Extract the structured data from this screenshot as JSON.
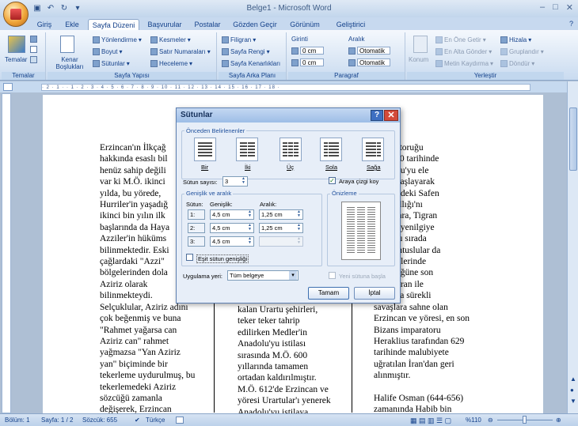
{
  "window": {
    "title": "Belge1 - Microsoft Word"
  },
  "tabs": [
    "Giriş",
    "Ekle",
    "Sayfa Düzeni",
    "Başvurular",
    "Postalar",
    "Gözden Geçir",
    "Görünüm",
    "Geliştirici"
  ],
  "ribbon": {
    "temalar": {
      "label": "Temalar",
      "btn": "Temalar"
    },
    "sayfa_yapisi": {
      "label": "Sayfa Yapısı",
      "kenar": "Kenar Boşlukları",
      "yonlendirme": "Yönlendirme",
      "boyut": "Boyut",
      "sutunlar": "Sütunlar",
      "kesmeler": "Kesmeler",
      "satir_numaralari": "Satır Numaraları",
      "heceleme": "Heceleme"
    },
    "sayfa_arka_plani": {
      "label": "Sayfa Arka Planı",
      "filigran": "Filigran",
      "sayfa_rengi": "Sayfa Rengi",
      "sayfa_kenarliklari": "Sayfa Kenarlıkları"
    },
    "paragraf": {
      "label": "Paragraf",
      "girinti": "Girinti",
      "aralik": "Aralık",
      "sol_val": "0 cm",
      "sag_val": "0 cm",
      "once_val": "Otomatik",
      "sonra_val": "Otomatik"
    },
    "yerlestir": {
      "label": "Yerleştir",
      "konum": "Konum",
      "en_one": "En Öne Getir",
      "en_alta": "En Alta Gönder",
      "metin_kaydirma": "Metin Kaydırma",
      "hizala": "Hizala",
      "gruplandir": "Gruplandır",
      "dondur": "Döndür"
    }
  },
  "document": {
    "col1": [
      "Erzincan'ın İlkçağ",
      "hakkında esaslı bil",
      "henüz sahip değili",
      "var ki M.Ö. ikinci",
      "yılda, bu yörede,",
      "Hurriler'in yaşadığ",
      "ikinci bin yılın ilk",
      "başlarında da Haya",
      "Azziler'in hüküms",
      "bilinmektedir. Eski",
      "çağlardaki \"Azzi\"",
      "bölgelerinden dola",
      "Aziriz olarak",
      "bilinmekteydi.",
      "Selçuklular, Aziriz adını",
      "çok beğenmiş ve buna",
      "\"Rahmet yağarsa can",
      "Aziriz can\" rahmet",
      "yağmazsa \"Yan Aziriz",
      "yan\" biçiminde bir",
      "tekerleme uydurulmuş, bu",
      "tekerlemedeki Aziriz",
      "sözcüğü zamanla",
      "değişerek, Erzincan"
    ],
    "col2": [
      "kalan Urartu şehirleri,",
      "teker teker tahrip",
      "edilirken Medler'in",
      "Anadolu'yu istilası",
      "sırasında M.Ö. 600",
      "yıllarında tamamen",
      "ortadan kaldırılmıştır.",
      "M.Ö. 612'de Erzincan ve",
      "yöresi Urartular'ı yenerek",
      "Anadolu'yu istilaya"
    ],
    "col3": [
      "İmparatoruğu",
      "M.Ö. 70 tarihinde",
      "Anadolu'yu ele",
      "meye başlayarak",
      "yöresindeki Safen",
      "at) Krallığı'nı",
      "dan sonra, Tigran",
      "unu da yenilgiye",
      "ıştır. Bu sırada",
      "68) Pontuslular da",
      "an yörelerinde",
      "üstünlüğüne son",
      "lerdir. İran ile",
      "arasında sürekli",
      "savaşlara sahne olan",
      "Erzincan ve yöresi, en son",
      "Bizans imparatoru",
      "Heraklius tarafından 629",
      "tarihinde malubiyete",
      "uğratılan İran'dan geri",
      "alınmıştır.",
      "",
      "Halife Osman (644-656)",
      "zamanında Habib bin"
    ]
  },
  "dialog": {
    "title": "Sütunlar",
    "presets_label": "Önceden Belirlenenler",
    "presets": [
      "Bir",
      "İki",
      "Üç",
      "Sola",
      "Sağa"
    ],
    "sutun_sayisi_label": "Sütun sayısı:",
    "sutun_sayisi": "3",
    "araya_cizgi": "Araya çizgi koy",
    "genislik_aralik": "Genişlik ve aralık",
    "onizleme": "Önizleme",
    "col_header_sutun": "Sütun:",
    "col_header_genislik": "Genişlik:",
    "col_header_aralik": "Aralık:",
    "rows": [
      {
        "n": "1:",
        "w": "4,5 cm",
        "s": "1,25 cm"
      },
      {
        "n": "2:",
        "w": "4,5 cm",
        "s": "1,25 cm"
      },
      {
        "n": "3:",
        "w": "4,5 cm",
        "s": ""
      }
    ],
    "esit": "Eşit sütun genişliği",
    "uygulama_label": "Uygulama yeri:",
    "uygulama_val": "Tüm belgeye",
    "yeni_sutun": "Yeni sütuna başla",
    "tamam": "Tamam",
    "iptal": "İptal"
  },
  "status": {
    "bolum": "Bölüm: 1",
    "sayfa": "Sayfa: 1 / 2",
    "sozcuk": "Sözcük: 655",
    "dil": "Türkçe",
    "zoom": "%110"
  }
}
